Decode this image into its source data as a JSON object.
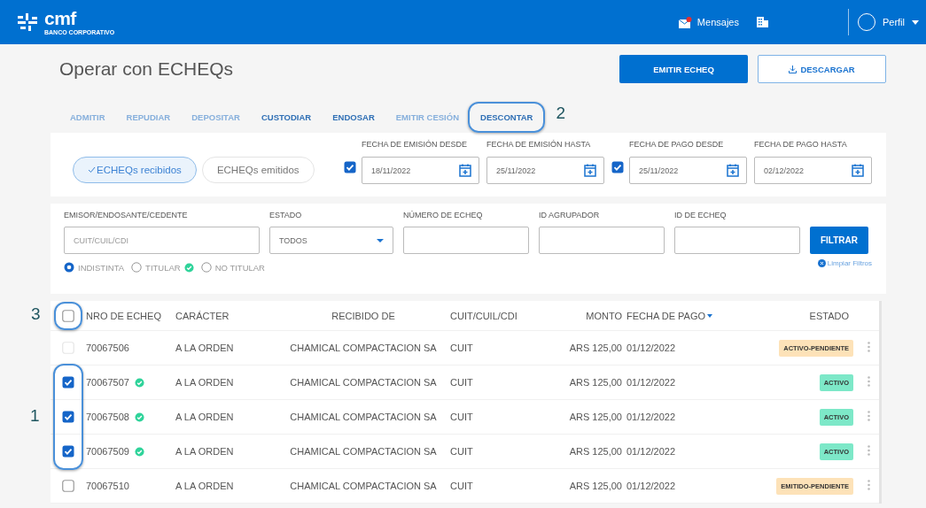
{
  "header": {
    "logo_text": "cmf",
    "logo_subtitle": "BANCO CORPORATIVO",
    "messages": "Mensajes",
    "messages_unread": true,
    "profile": "Perfil"
  },
  "page": {
    "title": "Operar con ECHEQs",
    "buttons": [
      {
        "label": "EMITIR ECHEQ",
        "kind": "primary"
      },
      {
        "label": "DESCARGAR",
        "kind": "outline"
      }
    ]
  },
  "actions": [
    {
      "label": "ADMITIR",
      "disabled": true
    },
    {
      "label": "REPUDIAR",
      "disabled": true
    },
    {
      "label": "DEPOSITAR",
      "disabled": true
    },
    {
      "label": "CUSTODIAR",
      "disabled": false
    },
    {
      "label": "ENDOSAR",
      "disabled": false
    },
    {
      "label": "EMITIR CESIÓN",
      "disabled": true
    },
    {
      "label": "DESCONTAR",
      "disabled": false
    }
  ],
  "segments": [
    {
      "label": "ECHEQs recibidos",
      "selected": true
    },
    {
      "label": "ECHEQs emitidos",
      "selected": false
    }
  ],
  "date_filters": [
    {
      "label": "FECHA DE EMISIÓN DESDE",
      "value": "18/11/2022",
      "kind": "toggle",
      "checked": true
    },
    {
      "label": "FECHA DE EMISIÓN HASTA",
      "value": "25/11/2022",
      "kind": "plain"
    },
    {
      "label": "FECHA DE PAGO DESDE",
      "value": "25/11/2022",
      "kind": "toggle",
      "checked": true
    },
    {
      "label": "FECHA DE PAGO HASTA",
      "value": "02/12/2022",
      "kind": "plain"
    }
  ],
  "fields": [
    {
      "label": "EMISOR/ENDOSANTE/CEDENTE",
      "kind": "text",
      "placeholder": "CUIT/CUIL/CDI"
    },
    {
      "label": "ESTADO",
      "kind": "select",
      "value": "TODOS"
    },
    {
      "label": "NÚMERO DE ECHEQ",
      "kind": "text"
    },
    {
      "label": "ID AGRUPADOR",
      "kind": "text"
    },
    {
      "label": "ID DE ECHEQ",
      "kind": "text"
    }
  ],
  "filter_button": "FILTRAR",
  "clear_link": "Limpiar Filtros",
  "radios": [
    {
      "label": "INDISTINTA",
      "selected": true,
      "verified": false
    },
    {
      "label": "TITULAR",
      "selected": false,
      "verified": true
    },
    {
      "label": "NO TITULAR",
      "selected": false,
      "verified": false
    }
  ],
  "table": {
    "select_all_checked": false,
    "columns": [
      {
        "label": "NRO DE ECHEQ",
        "sorted": false
      },
      {
        "label": "CARÁCTER",
        "sorted": false
      },
      {
        "label": "RECIBIDO DE",
        "sorted": false
      },
      {
        "label": "CUIT/CUIL/CDI",
        "sorted": false
      },
      {
        "label": "MONTO",
        "sorted": false
      },
      {
        "label": "FECHA DE PAGO",
        "sorted": true
      },
      {
        "label": "ESTADO",
        "sorted": false
      }
    ],
    "rows": [
      {
        "checked": false,
        "disabled": true,
        "verified": false,
        "cells": [
          "70067506",
          "A LA ORDEN",
          "CHAMICAL COMPACTACION SA",
          "CUIT",
          "ARS 125,00",
          "01/12/2022"
        ],
        "status": {
          "label": "ACTIVO-PENDIENTE",
          "color": "#fde2b8"
        }
      },
      {
        "checked": true,
        "disabled": false,
        "verified": true,
        "cells": [
          "70067507",
          "A LA ORDEN",
          "CHAMICAL COMPACTACION SA",
          "CUIT",
          "ARS 125,00",
          "01/12/2022"
        ],
        "status": {
          "label": "ACTIVO",
          "color": "#7de8c8"
        }
      },
      {
        "checked": true,
        "disabled": false,
        "verified": true,
        "cells": [
          "70067508",
          "A LA ORDEN",
          "CHAMICAL COMPACTACION SA",
          "CUIT",
          "ARS 125,00",
          "01/12/2022"
        ],
        "status": {
          "label": "ACTIVO",
          "color": "#7de8c8"
        }
      },
      {
        "checked": true,
        "disabled": false,
        "verified": true,
        "cells": [
          "70067509",
          "A LA ORDEN",
          "CHAMICAL COMPACTACION SA",
          "CUIT",
          "ARS 125,00",
          "01/12/2022"
        ],
        "status": {
          "label": "ACTIVO",
          "color": "#7de8c8"
        }
      },
      {
        "checked": false,
        "disabled": false,
        "verified": false,
        "cells": [
          "70067510",
          "A LA ORDEN",
          "CHAMICAL COMPACTACION SA",
          "CUIT",
          "ARS 125,00",
          "01/12/2022"
        ],
        "status": {
          "label": "EMITIDO-PENDIENTE",
          "color": "#fde2b8"
        }
      }
    ]
  },
  "annotations": [
    {
      "number": "1",
      "kind": "row-checkboxes"
    },
    {
      "number": "2",
      "kind": "action-tab"
    },
    {
      "number": "3",
      "kind": "select-all"
    }
  ]
}
